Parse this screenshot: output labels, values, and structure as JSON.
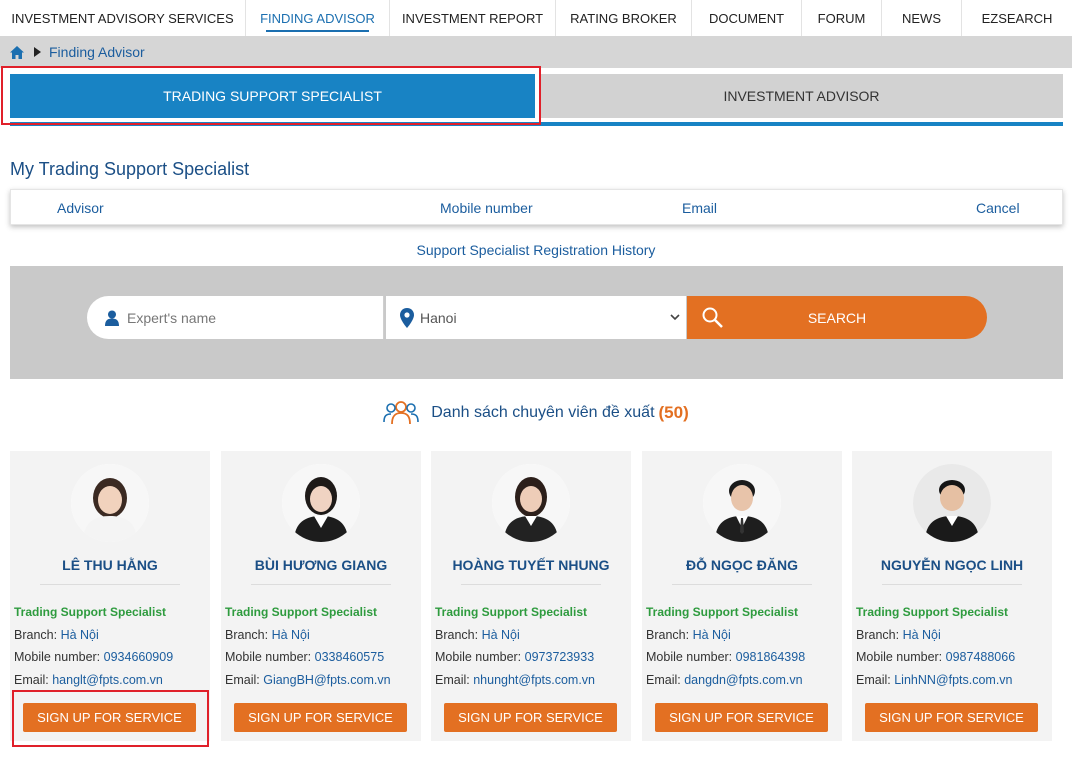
{
  "nav": {
    "items": [
      {
        "label": "INVESTMENT ADVISORY SERVICES"
      },
      {
        "label": "FINDING ADVISOR"
      },
      {
        "label": "INVESTMENT REPORT"
      },
      {
        "label": "RATING BROKER"
      },
      {
        "label": "DOCUMENT"
      },
      {
        "label": "FORUM"
      },
      {
        "label": "NEWS"
      },
      {
        "label": "EZSEARCH"
      }
    ],
    "active": "FINDING ADVISOR"
  },
  "breadcrumb": {
    "current": "Finding Advisor",
    "home_icon": "home-icon"
  },
  "tabs": [
    {
      "label": "TRADING SUPPORT SPECIALIST",
      "active": true
    },
    {
      "label": "INVESTMENT ADVISOR",
      "active": false
    }
  ],
  "my_section": {
    "title": "My Trading Support Specialist",
    "columns": [
      "Advisor",
      "Mobile number",
      "Email",
      "Cancel"
    ],
    "history_link": "Support Specialist Registration History"
  },
  "search": {
    "name_placeholder": "Expert's name",
    "location_value": "Hanoi",
    "button_label": "SEARCH"
  },
  "recommended": {
    "label": "Danh sách chuyên viên đề xuất",
    "count": "(50)"
  },
  "card_labels": {
    "branch": "Branch:",
    "mobile": "Mobile number:",
    "email": "Email:",
    "button": "SIGN UP FOR SERVICE"
  },
  "advisors": [
    {
      "name": "LÊ THU HẰNG",
      "role": "Trading Support Specialist",
      "branch": "Hà Nội",
      "mobile": "0934660909",
      "email": "hanglt@fpts.com.vn"
    },
    {
      "name": "BÙI HƯƠNG GIANG",
      "role": "Trading Support Specialist",
      "branch": "Hà Nội",
      "mobile": "0338460575",
      "email": "GiangBH@fpts.com.vn"
    },
    {
      "name": "HOÀNG TUYẾT NHUNG",
      "role": "Trading Support Specialist",
      "branch": "Hà Nội",
      "mobile": "0973723933",
      "email": "nhunght@fpts.com.vn"
    },
    {
      "name": "ĐỖ NGỌC ĐĂNG",
      "role": "Trading Support Specialist",
      "branch": "Hà Nội",
      "mobile": "0981864398",
      "email": "dangdn@fpts.com.vn"
    },
    {
      "name": "NGUYỄN NGỌC LINH",
      "role": "Trading Support Specialist",
      "branch": "Hà Nội",
      "mobile": "0987488066",
      "email": "LinhNN@fpts.com.vn"
    }
  ],
  "colors": {
    "primary_blue": "#1883c4",
    "accent_orange": "#e37022",
    "role_green": "#2e9b3e",
    "highlight_red": "#e0202a"
  }
}
